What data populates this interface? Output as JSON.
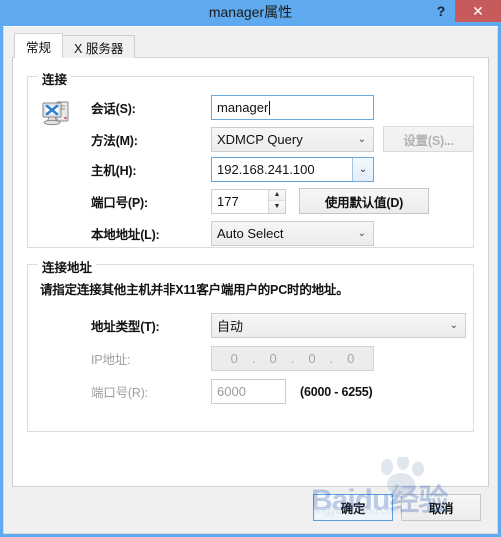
{
  "window": {
    "title": "manager属性",
    "help_label": "?",
    "close_label": "✕",
    "accent_color": "#5faaee",
    "close_color": "#c75b5b"
  },
  "tabs": [
    {
      "label": "常规",
      "active": true
    },
    {
      "label": "X 服务器",
      "active": false
    }
  ],
  "connection_group": {
    "title": "连接",
    "icon": "computer-x-icon",
    "rows": {
      "session": {
        "label": "会话(S):",
        "value": "manager"
      },
      "method": {
        "label": "方法(M):",
        "value": "XDMCP Query",
        "chevron": "⌄"
      },
      "host": {
        "label": "主机(H):",
        "value": "192.168.241.100",
        "chevron": "⌄"
      },
      "port": {
        "label": "端口号(P):",
        "value": "177",
        "up": "▲",
        "down": "▼"
      },
      "local_address": {
        "label": "本地地址(L):",
        "value": "Auto Select",
        "chevron": "⌄"
      }
    },
    "buttons": {
      "settings": {
        "label": "设置(S)...",
        "disabled": true
      },
      "use_default": {
        "label": "使用默认值(D)",
        "disabled": false
      }
    }
  },
  "address_group": {
    "title": "连接地址",
    "description": "请指定连接其他主机并非X11客户端用户的PC时的地址。",
    "rows": {
      "addr_type": {
        "label": "地址类型(T):",
        "value": "自动",
        "chevron": "⌄"
      },
      "ip_address": {
        "label": "IP地址:",
        "octets": [
          "0",
          "0",
          "0",
          "0"
        ],
        "separator": "."
      },
      "port": {
        "label": "端口号(R):",
        "value": "6000",
        "range_note": "(6000 - 6255)"
      }
    }
  },
  "footer": {
    "ok_label": "确定",
    "cancel_label": "取消"
  },
  "watermark": {
    "brand": "Baidu经验",
    "url": "jingyan.baidu.com"
  }
}
